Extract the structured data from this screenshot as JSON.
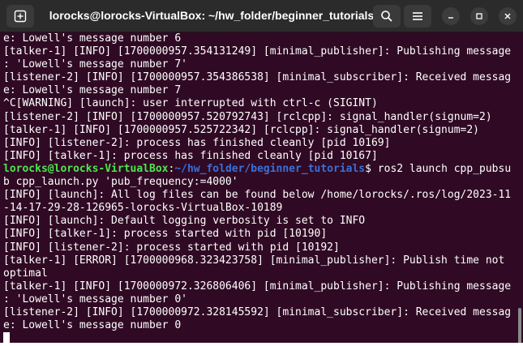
{
  "window": {
    "title": "lorocks@lorocks-VirtualBox: ~/hw_folder/beginner_tutorials"
  },
  "header": {
    "new_tab_icon": "new-tab-icon",
    "search_icon": "search-icon",
    "menu_icon": "hamburger-menu-icon",
    "minimize_icon": "minimize-icon",
    "maximize_icon": "maximize-icon",
    "close_icon": "close-icon"
  },
  "colors": {
    "terminal_bg": "#300a24",
    "prompt_user": "#4ce64c",
    "prompt_path": "#3b6fd4",
    "text": "#ffffff"
  },
  "terminal": {
    "lines": [
      "e: Lowell's message number 6",
      "[talker-1] [INFO] [1700000957.354131249] [minimal_publisher]: Publishing message",
      ": 'Lowell's message number 7'",
      "[listener-2] [INFO] [1700000957.354386538] [minimal_subscriber]: Received messag",
      "e: Lowell's message number 7",
      "^C[WARNING] [launch]: user interrupted with ctrl-c (SIGINT)",
      "[listener-2] [INFO] [1700000957.520792743] [rclcpp]: signal_handler(signum=2)",
      "[talker-1] [INFO] [1700000957.525722342] [rclcpp]: signal_handler(signum=2)",
      "[INFO] [listener-2]: process has finished cleanly [pid 10169]",
      "[INFO] [talker-1]: process has finished cleanly [pid 10167]"
    ],
    "prompt": {
      "user_host": "lorocks@lorocks-VirtualBox",
      "sep": ":",
      "path": "~/hw_folder/beginner_tutorials",
      "symbol": "$ ",
      "command": "ros2 launch cpp_pubsu"
    },
    "lines_after": [
      "b cpp_launch.py 'pub_frequency:=4000'",
      "[INFO] [launch]: All log files can be found below /home/lorocks/.ros/log/2023-11",
      "-14-17-29-28-126965-lorocks-VirtualBox-10189",
      "[INFO] [launch]: Default logging verbosity is set to INFO",
      "[INFO] [talker-1]: process started with pid [10190]",
      "[INFO] [listener-2]: process started with pid [10192]",
      "[talker-1] [ERROR] [1700000968.323423758] [minimal_publisher]: Publish time not",
      "optimal",
      "[talker-1] [INFO] [1700000972.326806406] [minimal_publisher]: Publishing message",
      ": 'Lowell's message number 0'",
      "[listener-2] [INFO] [1700000972.328145592] [minimal_subscriber]: Received messag",
      "e: Lowell's message number 0"
    ]
  }
}
